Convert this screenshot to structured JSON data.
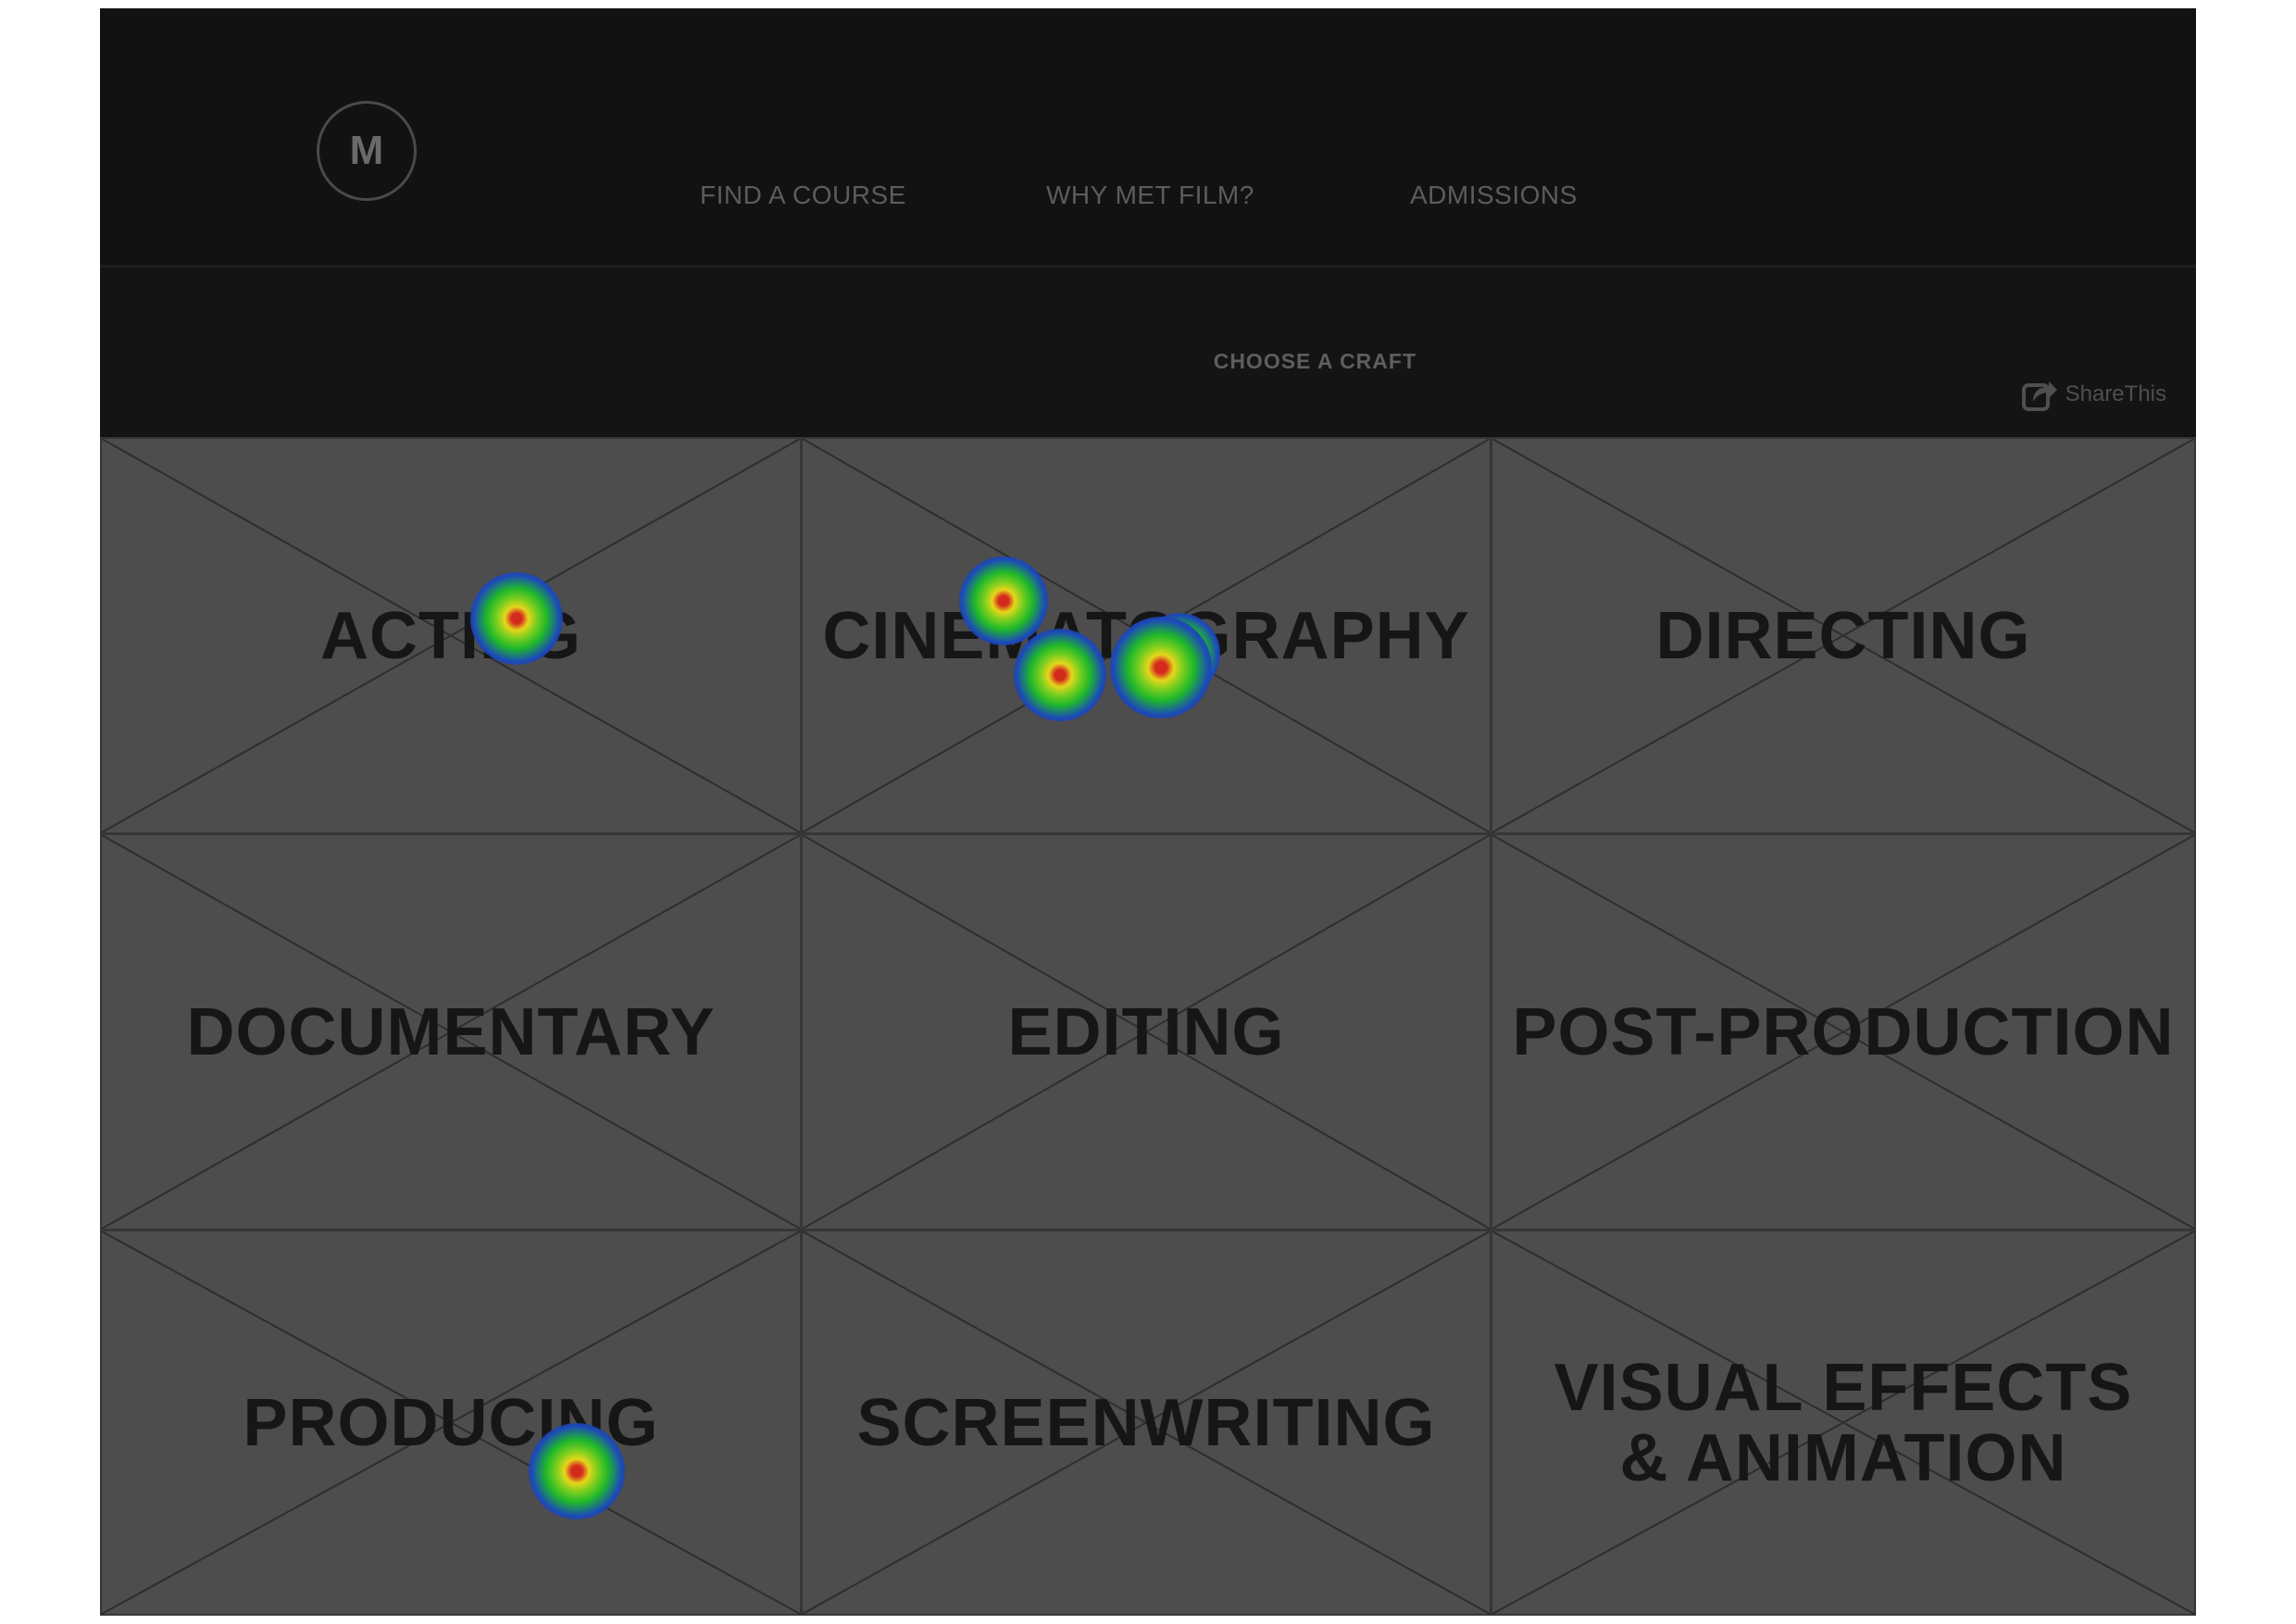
{
  "header": {
    "logo_letter": "M",
    "nav": [
      {
        "label": "FIND A COURSE"
      },
      {
        "label": "WHY MET FILM?"
      },
      {
        "label": "ADMISSIONS"
      }
    ]
  },
  "subheader": {
    "title": "CHOOSE A CRAFT",
    "share_label": "ShareThis",
    "share_icon": "share-icon"
  },
  "crafts": [
    {
      "label": "ACTING"
    },
    {
      "label": "CINEMATOGRAPHY"
    },
    {
      "label": "DIRECTING"
    },
    {
      "label": "DOCUMENTARY"
    },
    {
      "label": "EDITING"
    },
    {
      "label": "POST-PRODUCTION"
    },
    {
      "label": "PRODUCING"
    },
    {
      "label": "SCREENWRITING"
    },
    {
      "label": "VISUAL EFFECTS\n& ANIMATION"
    }
  ],
  "colors": {
    "tile_background": "#4d4d4d",
    "tile_text": "#161616",
    "header_background": "#121212",
    "nav_text": "#5c5c5c"
  }
}
